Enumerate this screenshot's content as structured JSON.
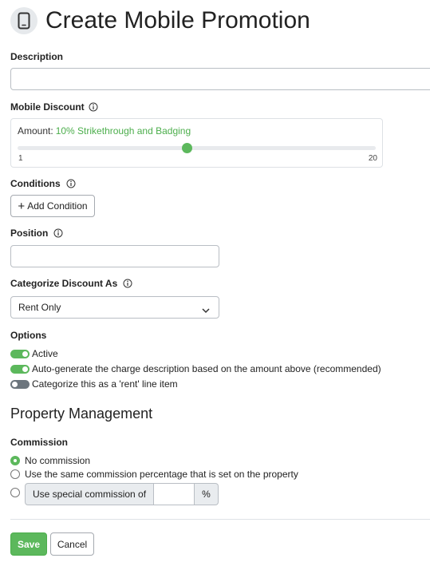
{
  "header": {
    "title": "Create Mobile Promotion",
    "icon": "mobile-phone-icon"
  },
  "description": {
    "label": "Description",
    "value": ""
  },
  "mobile_discount": {
    "label": "Mobile Discount",
    "amount_label": "Amount:",
    "amount_value": "10% Strikethrough and Badging",
    "slider_min": "1",
    "slider_max": "20",
    "slider_value": 10
  },
  "conditions": {
    "label": "Conditions",
    "add_button": "Add Condition"
  },
  "position": {
    "label": "Position",
    "value": ""
  },
  "categorize": {
    "label": "Categorize Discount As",
    "selected": "Rent Only"
  },
  "options": {
    "label": "Options",
    "items": [
      {
        "label": "Active",
        "on": true
      },
      {
        "label": "Auto-generate the charge description based on the amount above (recommended)",
        "on": true
      },
      {
        "label": "Categorize this as a 'rent' line item",
        "on": false
      }
    ]
  },
  "property_management": {
    "title": "Property Management",
    "commission_label": "Commission",
    "options": [
      {
        "label": "No commission",
        "checked": true
      },
      {
        "label": "Use the same commission percentage that is set on the property",
        "checked": false
      },
      {
        "label": "Use special commission of",
        "checked": false
      }
    ],
    "percent_suffix": "%",
    "special_value": ""
  },
  "actions": {
    "save": "Save",
    "cancel": "Cancel"
  },
  "colors": {
    "accent": "#5cb85c",
    "text": "#222222",
    "border": "#b9bec4"
  }
}
